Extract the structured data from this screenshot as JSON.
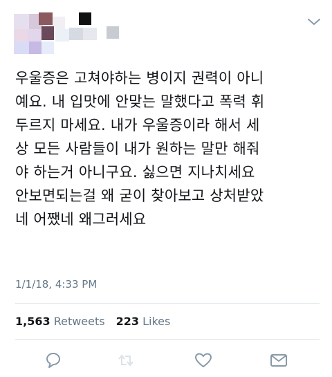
{
  "header": {
    "avatar_icon": "blurred-avatar-mosaic",
    "menu_icon": "chevron-down-icon"
  },
  "tweet": {
    "lines": [
      "우울증은 고쳐야하는 병이지 권력이 아니",
      "예요. 내 입맛에 안맞는 말했다고 폭력 휘",
      "두르지 마세요. 내가 우울증이라 해서 세",
      "상 모든 사람들이 내가 원하는 말만 해줘",
      "야 하는거 아니구요. 싫으면 지나치세요",
      "안보면되는걸 왜 굳이 찾아보고 상처받았",
      "네 어쨌네 왜그러세요"
    ],
    "timestamp": "1/1/18, 4:33 PM"
  },
  "stats": {
    "retweets_count": "1,563",
    "retweets_label": "Retweets",
    "likes_count": "223",
    "likes_label": "Likes"
  },
  "actions": [
    {
      "name": "reply-icon"
    },
    {
      "name": "retweet-icon"
    },
    {
      "name": "like-icon"
    },
    {
      "name": "message-icon"
    }
  ],
  "colors": {
    "text": "#14171a",
    "secondary": "#657786",
    "icon": "#8899a6",
    "divider": "#e1e8ed"
  }
}
